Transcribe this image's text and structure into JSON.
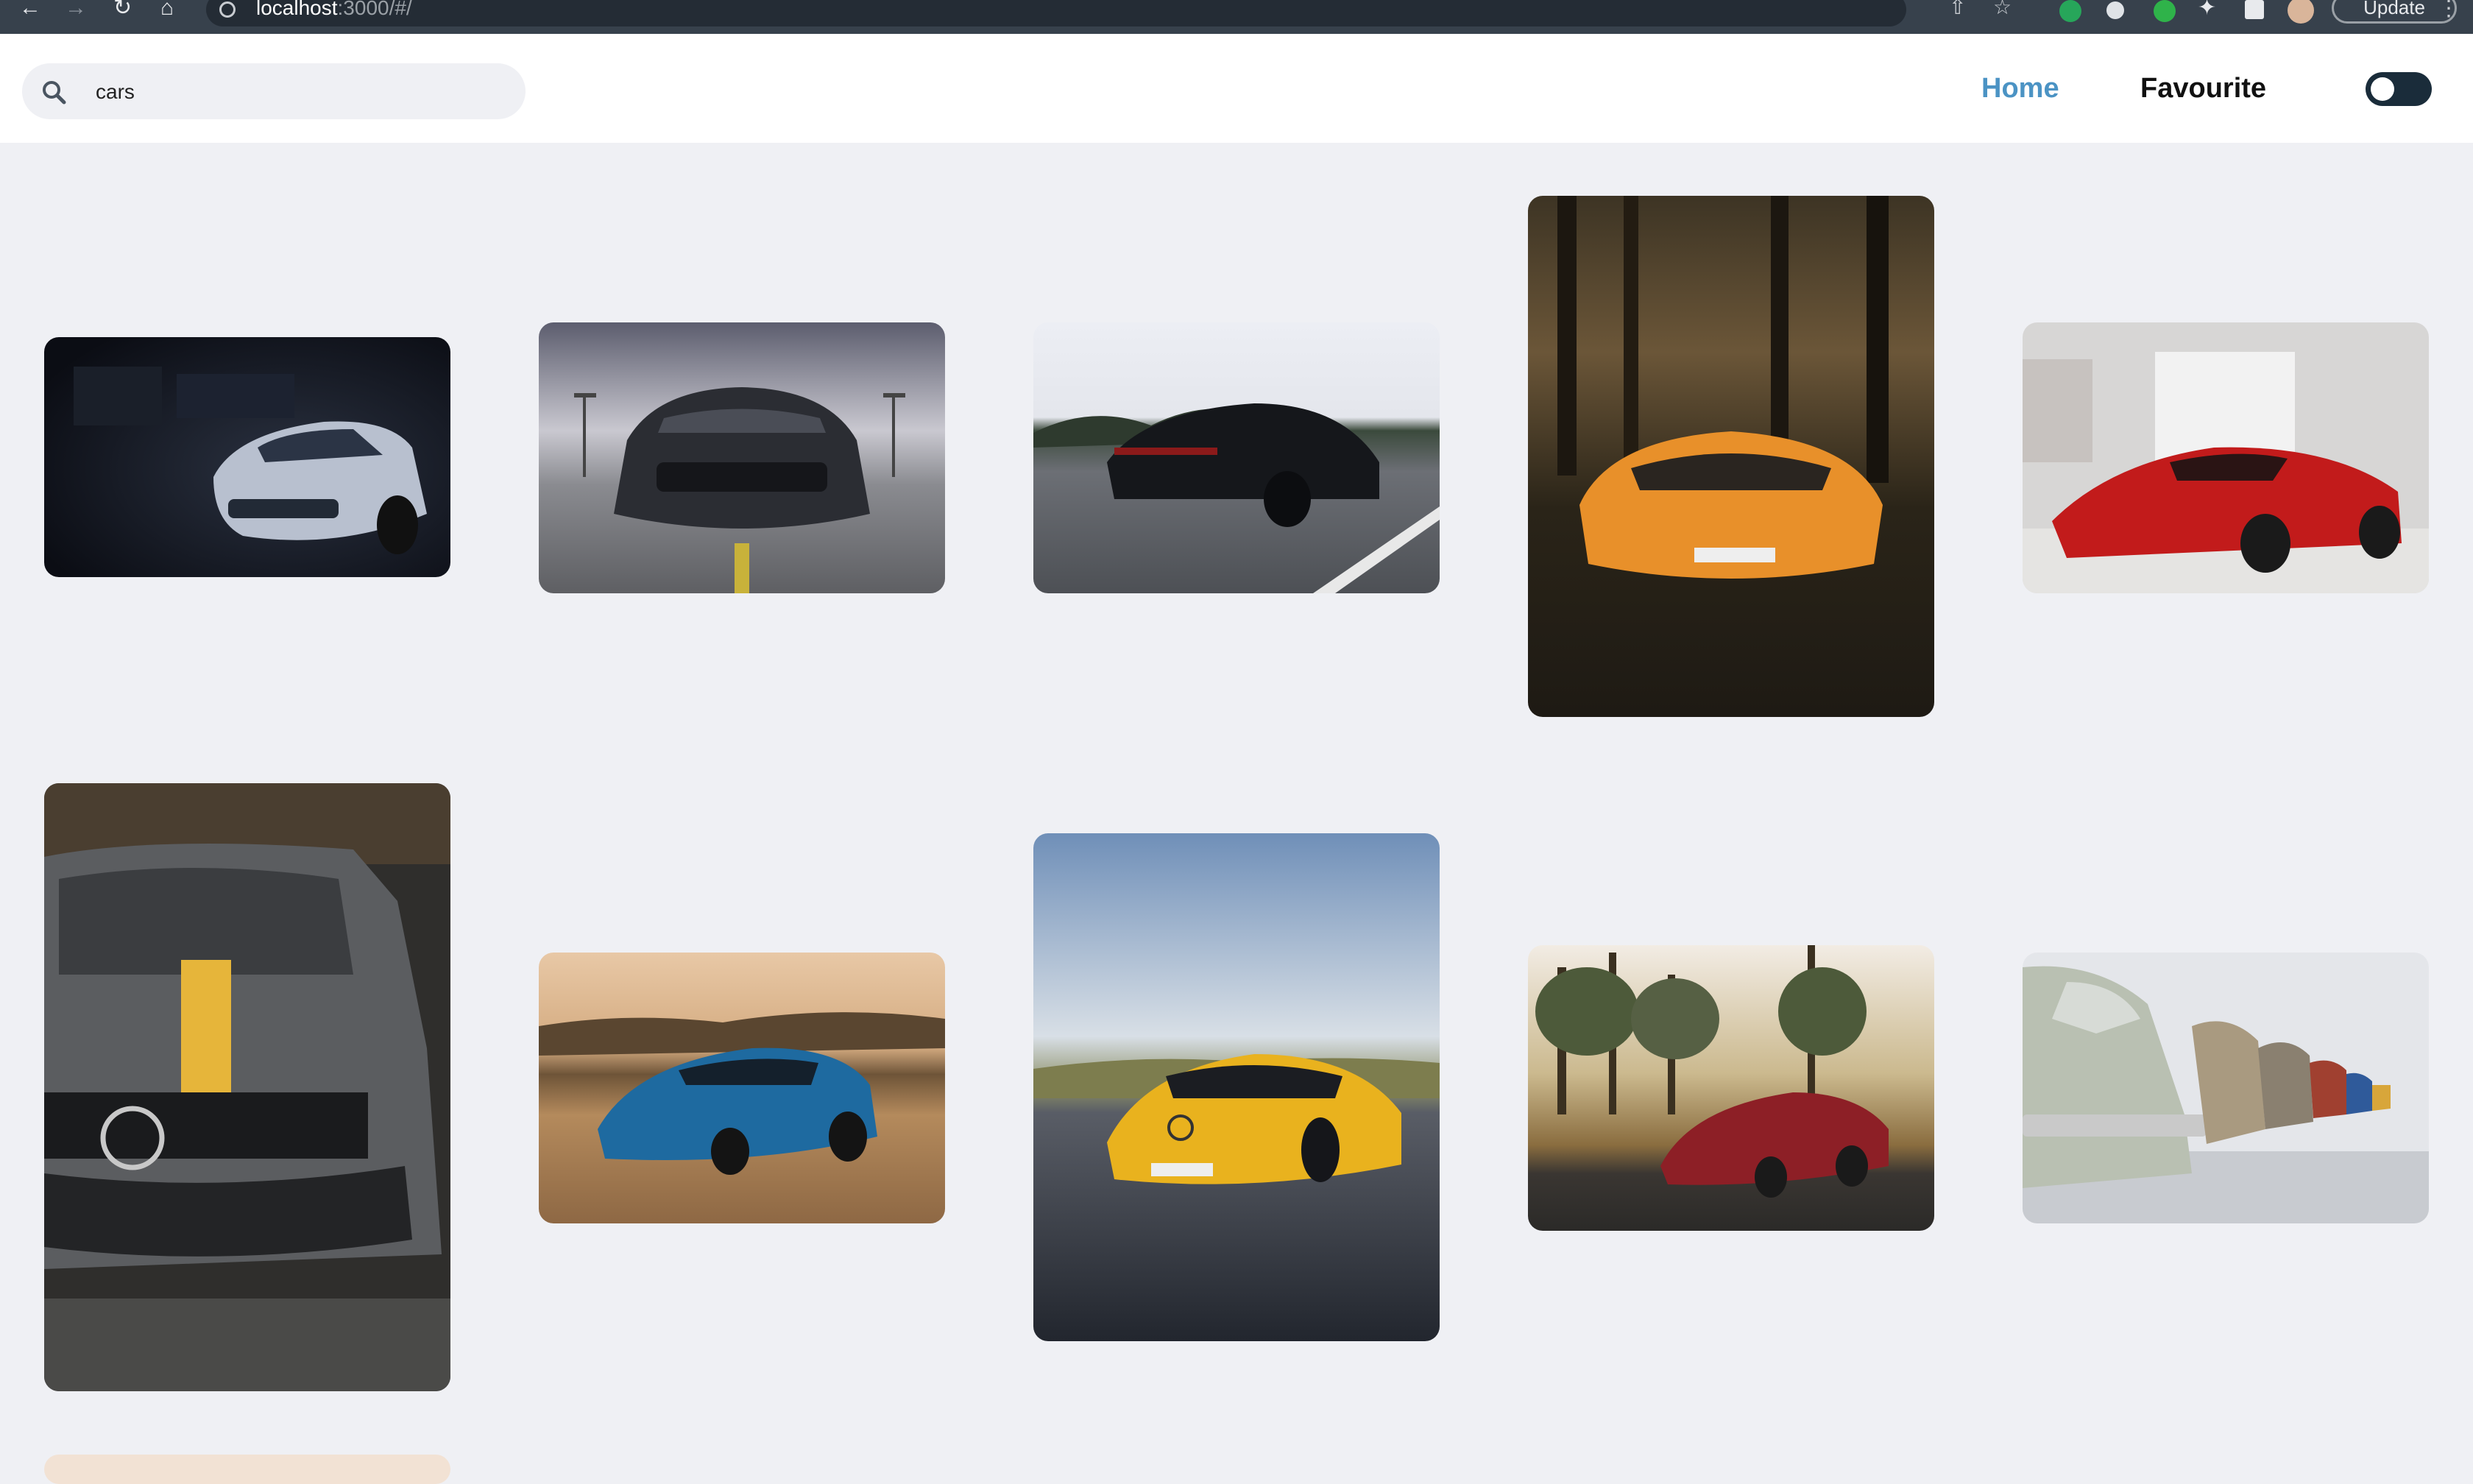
{
  "browser": {
    "url_host": "localhost",
    "url_rest": ":3000/#/",
    "update_label": "Update",
    "icons": [
      "back-arrow-icon",
      "forward-arrow-icon",
      "reload-icon",
      "home-icon",
      "info-icon",
      "share-icon",
      "bookmark-star-icon",
      "grammarly-icon",
      "extension-icon",
      "puzzle-icon",
      "sidebar-icon",
      "profile-avatar",
      "kebab-menu-icon"
    ]
  },
  "header": {
    "search": {
      "value": "cars",
      "placeholder": "Search"
    },
    "nav": {
      "home_label": "Home",
      "favourite_label": "Favourite"
    },
    "theme_toggle": {
      "state": "off"
    },
    "accent_color": "#4b93c4"
  },
  "gallery": {
    "items": [
      {
        "subject": "silver camaro in dark garage"
      },
      {
        "subject": "black mustang on parking deck"
      },
      {
        "subject": "black porsche panamera on road"
      },
      {
        "subject": "orange lamborghini aventador in forest"
      },
      {
        "subject": "red laferrari in showroom"
      },
      {
        "subject": "grey mercedes amg with yellow stripe"
      },
      {
        "subject": "blue camaro in desert"
      },
      {
        "subject": "yellow mercedes amg gt on road"
      },
      {
        "subject": "red mercedes amg gt among pine trees"
      },
      {
        "subject": "row of classic bmw cars"
      },
      {
        "subject": "partially visible card"
      }
    ]
  }
}
